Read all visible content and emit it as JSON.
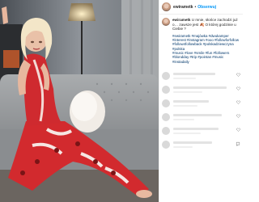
{
  "post": {
    "username": "ewirametk",
    "follow_label": "Obserwuj",
    "caption_text": "U mnie, słońce zachodzi już o… zawsze jest 🍂 O której godzinie u Ciebie ?",
    "hashtags": [
      "#ewirametk #majówka #dwukamper",
      "#interest #instagram #ooo #followforfollow",
      "#follow4followback #polskadziewczyna #polska",
      "#music #love #smile #fun #followers",
      "#blondday #trip #pointan #music #instadaily"
    ],
    "media_alt_icon": "photo-icon"
  },
  "colors": {
    "accent": "#0095f6",
    "text": "#262626",
    "hashtag": "#00376b",
    "divider": "#efefef",
    "placeholder": "#e3e3e3"
  }
}
